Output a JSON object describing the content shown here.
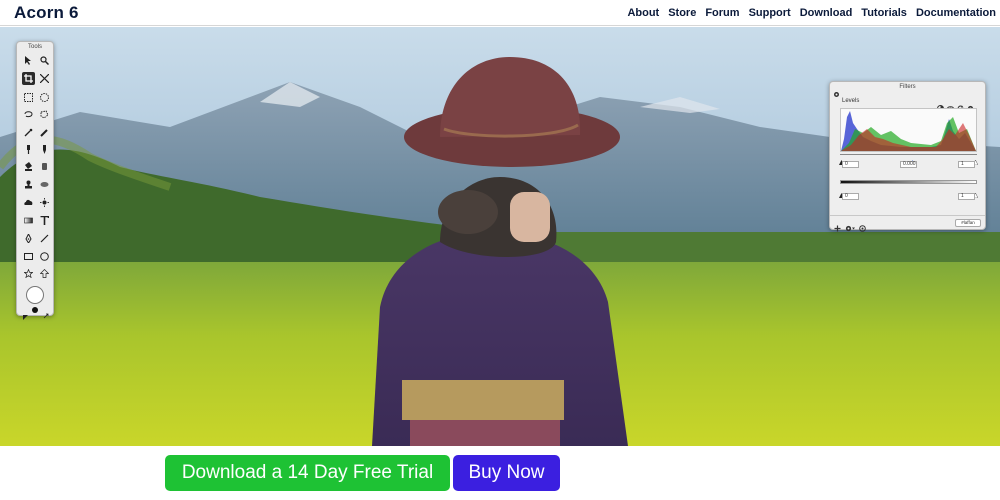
{
  "header": {
    "brand": "Acorn 6",
    "nav": [
      "About",
      "Store",
      "Forum",
      "Support",
      "Download",
      "Tutorials",
      "Documentation"
    ]
  },
  "tools_palette": {
    "title": "Tools"
  },
  "filters_palette": {
    "title": "Filters",
    "section": "Levels",
    "input_low": "0",
    "input_mid": "0.000",
    "input_high": "1",
    "output_low": "0",
    "output_high": "1",
    "footer_button": "#laffan"
  },
  "cta": {
    "trial_label": "Download a 14 Day Free Trial",
    "buy_label": "Buy Now"
  },
  "colors": {
    "brand_text": "#0b1a3a",
    "trial_green": "#1ec234",
    "buy_blue": "#3b1fe0"
  }
}
